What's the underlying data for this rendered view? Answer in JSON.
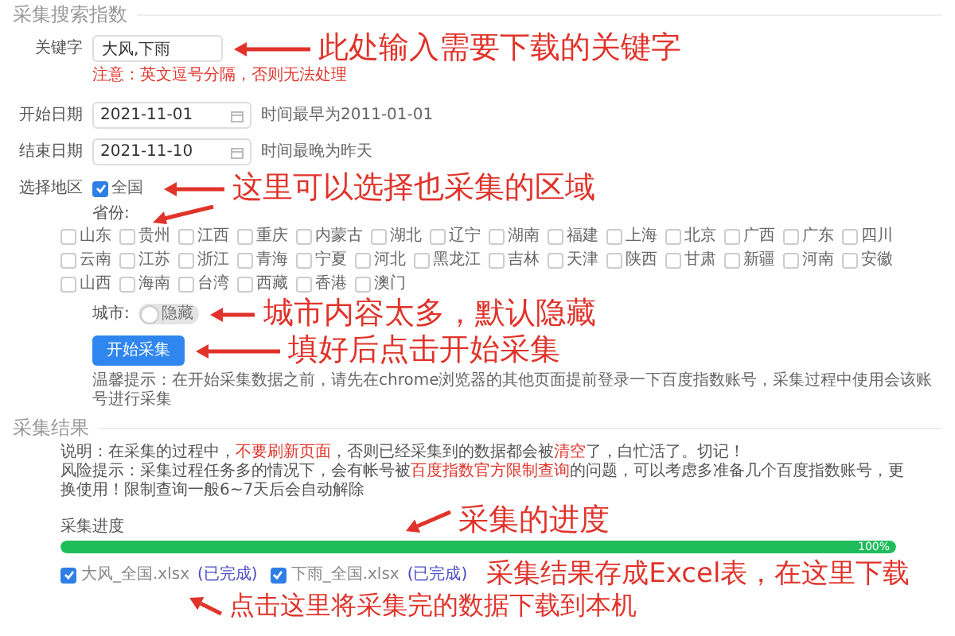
{
  "search_section": {
    "title": "采集搜索指数",
    "keyword": {
      "label": "关键字",
      "value": "大风,下雨",
      "note": "注意：英文逗号分隔，否则无法处理"
    },
    "start_date": {
      "label": "开始日期",
      "value": "2021-11-01",
      "hint": "时间最早为2011-01-01"
    },
    "end_date": {
      "label": "结束日期",
      "value": "2021-11-10",
      "hint": "时间最晚为昨天"
    },
    "region": {
      "label": "选择地区",
      "nationwide": {
        "label": "全国",
        "checked": true
      },
      "provinces_label": "省份:",
      "provinces": [
        {
          "label": "山东",
          "checked": false
        },
        {
          "label": "贵州",
          "checked": false
        },
        {
          "label": "江西",
          "checked": false
        },
        {
          "label": "重庆",
          "checked": false
        },
        {
          "label": "内蒙古",
          "checked": false
        },
        {
          "label": "湖北",
          "checked": false
        },
        {
          "label": "辽宁",
          "checked": false
        },
        {
          "label": "湖南",
          "checked": false
        },
        {
          "label": "福建",
          "checked": false
        },
        {
          "label": "上海",
          "checked": false
        },
        {
          "label": "北京",
          "checked": false
        },
        {
          "label": "广西",
          "checked": false
        },
        {
          "label": "广东",
          "checked": false
        },
        {
          "label": "四川",
          "checked": false
        },
        {
          "label": "云南",
          "checked": false
        },
        {
          "label": "江苏",
          "checked": false
        },
        {
          "label": "浙江",
          "checked": false
        },
        {
          "label": "青海",
          "checked": false
        },
        {
          "label": "宁夏",
          "checked": false
        },
        {
          "label": "河北",
          "checked": false
        },
        {
          "label": "黑龙江",
          "checked": false
        },
        {
          "label": "吉林",
          "checked": false
        },
        {
          "label": "天津",
          "checked": false
        },
        {
          "label": "陕西",
          "checked": false
        },
        {
          "label": "甘肃",
          "checked": false
        },
        {
          "label": "新疆",
          "checked": false
        },
        {
          "label": "河南",
          "checked": false
        },
        {
          "label": "安徽",
          "checked": false
        },
        {
          "label": "山西",
          "checked": false
        },
        {
          "label": "海南",
          "checked": false
        },
        {
          "label": "台湾",
          "checked": false
        },
        {
          "label": "西藏",
          "checked": false
        },
        {
          "label": "香港",
          "checked": false
        },
        {
          "label": "澳门",
          "checked": false
        }
      ],
      "city": {
        "label": "城市:",
        "switch_text": "隐藏",
        "on": false
      }
    },
    "start_button": "开始采集",
    "tip": "温馨提示：在开始采集数据之前，请先在chrome浏览器的其他页面提前登录一下百度指数账号，采集过程中使用会该账号进行采集"
  },
  "result_section": {
    "title": "采集结果",
    "notes": [
      "说明：在采集的过程中，**不要刷新页面**，否则已经采集到的数据都会被**清空**了，白忙活了。切记！",
      "风险提示：采集过程任务多的情况下，会有帐号被**百度指数官方限制查询**的问题，可以考虑多准备几个百度指数账号，更换使用！限制查询一般6~7天后会自动解除"
    ],
    "progress": {
      "label": "采集进度",
      "level": 1,
      "reading": "100%"
    },
    "files": [
      {
        "name": "大风_全国.xlsx",
        "status": "(已完成)",
        "checked": true
      },
      {
        "name": "下雨_全国.xlsx",
        "status": "(已完成)",
        "checked": true
      }
    ]
  },
  "annotations": [
    {
      "text": "此处输入需要下载的关键字"
    },
    {
      "text": "这里可以选择也采集的区域"
    },
    {
      "text": "城市内容太多，默认隐藏"
    },
    {
      "text": "填好后点击开始采集"
    },
    {
      "text": "采集的进度"
    },
    {
      "text": "采集结果存成Excel表，在这里下载"
    },
    {
      "text": "点击这里将采集完的数据下载到本机"
    }
  ]
}
